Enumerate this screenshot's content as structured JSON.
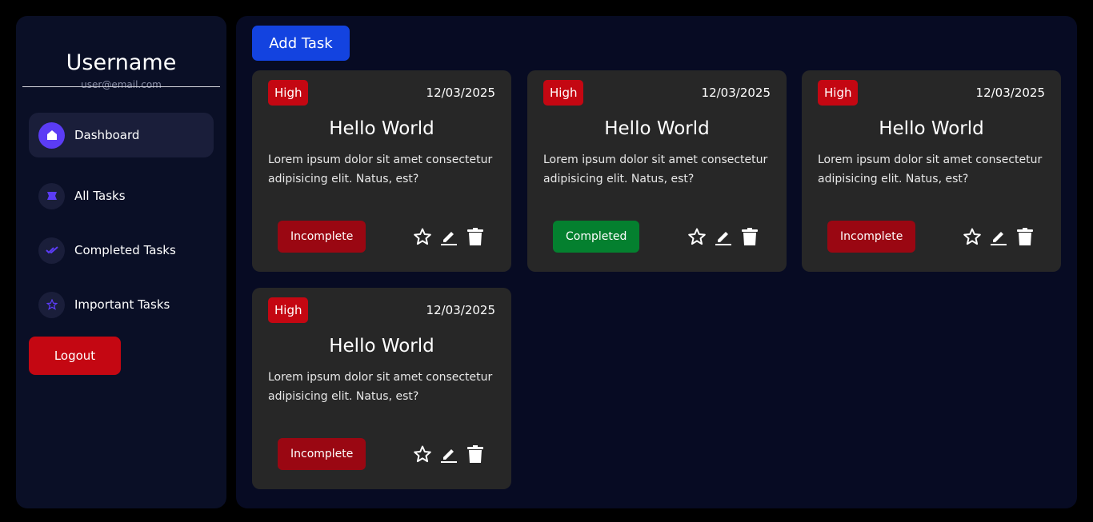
{
  "sidebar": {
    "username": "Username",
    "email": "user@email.com",
    "items": [
      {
        "label": "Dashboard",
        "icon": "home-icon"
      },
      {
        "label": "All Tasks",
        "icon": "list-icon"
      },
      {
        "label": "Completed Tasks",
        "icon": "double-check-icon"
      },
      {
        "label": "Important Tasks",
        "icon": "star-icon"
      }
    ],
    "logout_label": "Logout"
  },
  "main": {
    "add_task_label": "Add Task"
  },
  "tasks": [
    {
      "priority": "High",
      "date": "12/03/2025",
      "title": "Hello World",
      "description": "Lorem ipsum dolor sit amet consectetur adipisicing elit. Natus, est?",
      "status": "Incomplete"
    },
    {
      "priority": "High",
      "date": "12/03/2025",
      "title": "Hello World",
      "description": "Lorem ipsum dolor sit amet consectetur adipisicing elit. Natus, est?",
      "status": "Completed"
    },
    {
      "priority": "High",
      "date": "12/03/2025",
      "title": "Hello World",
      "description": "Lorem ipsum dolor sit amet consectetur adipisicing elit. Natus, est?",
      "status": "Incomplete"
    },
    {
      "priority": "High",
      "date": "12/03/2025",
      "title": "Hello World",
      "description": "Lorem ipsum dolor sit amet consectetur adipisicing elit. Natus, est?",
      "status": "Incomplete"
    }
  ],
  "colors": {
    "priority_high": "#c40712",
    "status_incomplete": "#9a0712",
    "status_completed": "#04802f",
    "accent": "#5b3cf5",
    "add_button": "#1343e0"
  }
}
